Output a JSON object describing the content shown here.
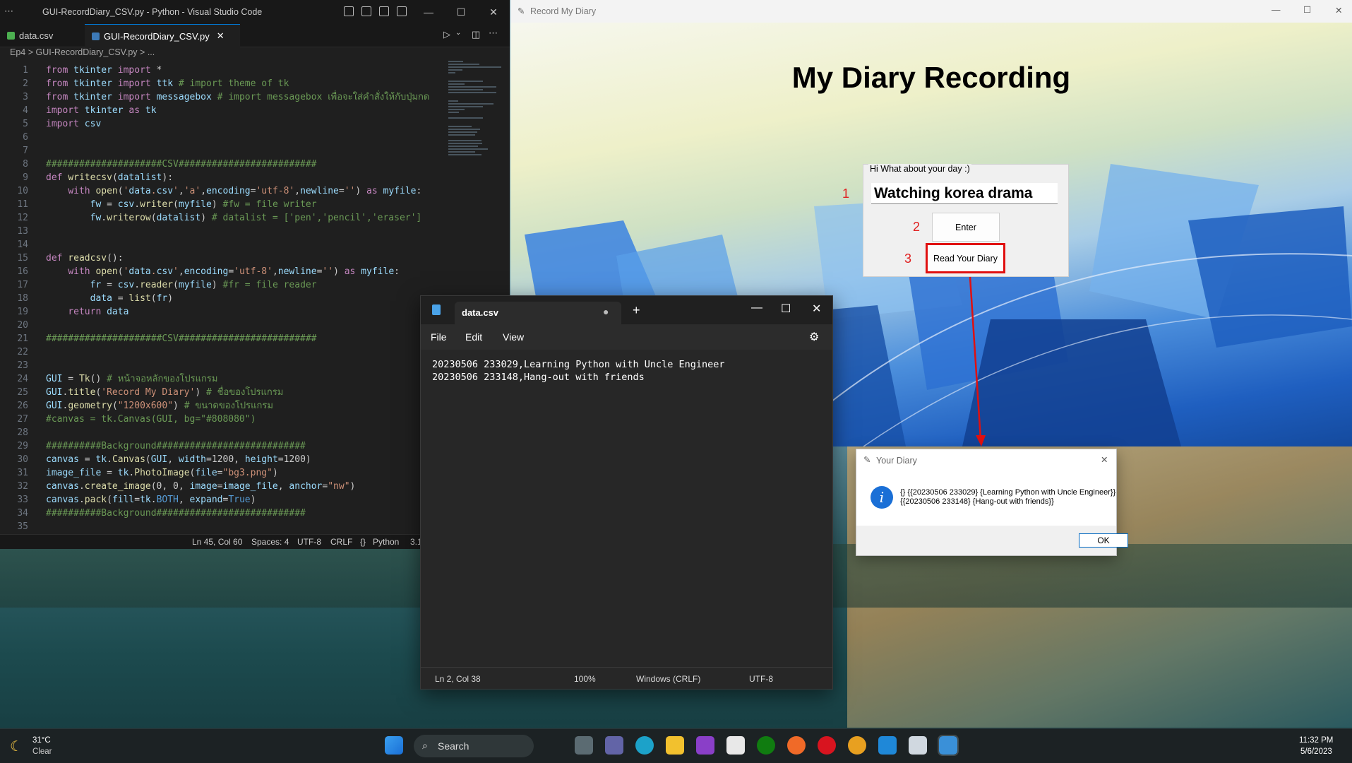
{
  "vscode": {
    "title": "GUI-RecordDiary_CSV.py - Python - Visual Studio Code",
    "tabs": [
      "data.csv",
      "GUI-RecordDiary_CSV.py"
    ],
    "breadcrumb": [
      "Ep4",
      "GUI-RecordDiary_CSV.py",
      "..."
    ],
    "code_lines": [
      "from tkinter import *",
      "from tkinter import ttk # import theme of tk",
      "from tkinter import messagebox # import messagebox เพื่อจะใส่คำสั่งให้กับปุ่มกด",
      "import tkinter as tk",
      "import csv",
      "",
      "",
      "#####################CSV#########################",
      "def writecsv(datalist):",
      "    with open('data.csv','a',encoding='utf-8',newline='') as myfile:",
      "        fw = csv.writer(myfile) #fw = file writer",
      "        fw.writerow(datalist) # datalist = ['pen','pencil','eraser']",
      "",
      "",
      "def readcsv():",
      "    with open('data.csv',encoding='utf-8',newline='') as myfile:",
      "        fr = csv.reader(myfile) #fr = file reader",
      "        data = list(fr)",
      "    return data",
      "",
      "#####################CSV#########################",
      "",
      "",
      "GUI = Tk() # หน้าจอหลักของโปรแกรม",
      "GUI.title('Record My Diary') # ชื่อของโปรแกรม",
      "GUI.geometry(\"1200x600\") # ขนาดของโปรแกรม",
      "#canvas = tk.Canvas(GUI, bg=\"#808080\")",
      "",
      "##########Background###########################",
      "canvas = tk.Canvas(GUI, width=1200, height=1200)",
      "image_file = tk.PhotoImage(file=\"bg3.png\")",
      "canvas.create_image(0, 0, image=image_file, anchor=\"nw\")",
      "canvas.pack(fill=tk.BOTH, expand=True)",
      "##########Background###########################",
      ""
    ],
    "status": {
      "position": "Ln 45, Col 60",
      "spaces": "Spaces: 4",
      "encoding": "UTF-8",
      "eol": "CRLF",
      "language": "Python",
      "version": "3.1"
    }
  },
  "diary": {
    "title": "Record My Diary",
    "heading": "My Diary Recording",
    "frame_label": "Hi What about your day :)",
    "entry_value": "Watching korea drama",
    "enter_label": "Enter",
    "read_label": "Read Your Diary",
    "step_numbers": [
      "1",
      "2",
      "3"
    ]
  },
  "notepad": {
    "tab_title": "data.csv",
    "menu": [
      "File",
      "Edit",
      "View"
    ],
    "lines": [
      "20230506 233029,Learning Python with Uncle Engineer",
      "20230506 233148,Hang-out with friends"
    ],
    "status": {
      "position": "Ln 2, Col 38",
      "zoom": "100%",
      "eol": "Windows (CRLF)",
      "encoding": "UTF-8"
    }
  },
  "dialog": {
    "title": "Your Diary",
    "message_line1": "{} {{20230506 233029} {Learning Python with Uncle Engineer}}",
    "message_line2": "{{20230506 233148} {Hang-out with friends}}",
    "ok_label": "OK"
  },
  "taskbar": {
    "weather_temp": "31°C",
    "weather_desc": "Clear",
    "search_label": "Search",
    "time": "11:32 PM",
    "date": "5/6/2023"
  },
  "colors": {
    "accent": "#0078d4",
    "highlight": "#e01010",
    "info": "#1a6fd6"
  }
}
